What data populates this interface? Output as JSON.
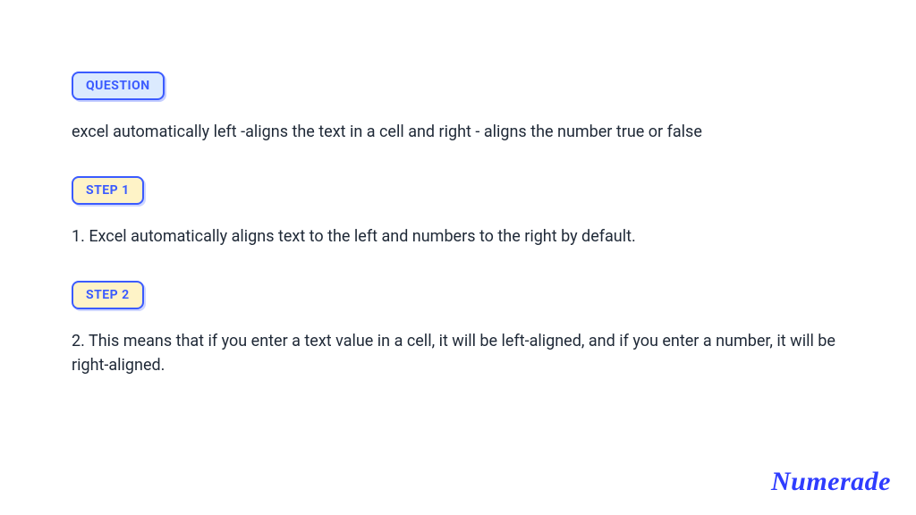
{
  "badges": {
    "question": "QUESTION",
    "step1": "STEP 1",
    "step2": "STEP 2"
  },
  "question_text": "excel automatically left -aligns the text in a cell and right - aligns the number true or false",
  "step1_text": "1. Excel automatically aligns text to the left and numbers to the right by default.",
  "step2_text": "2. This means that if you enter a text value in a cell, it will be left-aligned, and if you enter a number, it will be right-aligned.",
  "logo": "Numerade"
}
